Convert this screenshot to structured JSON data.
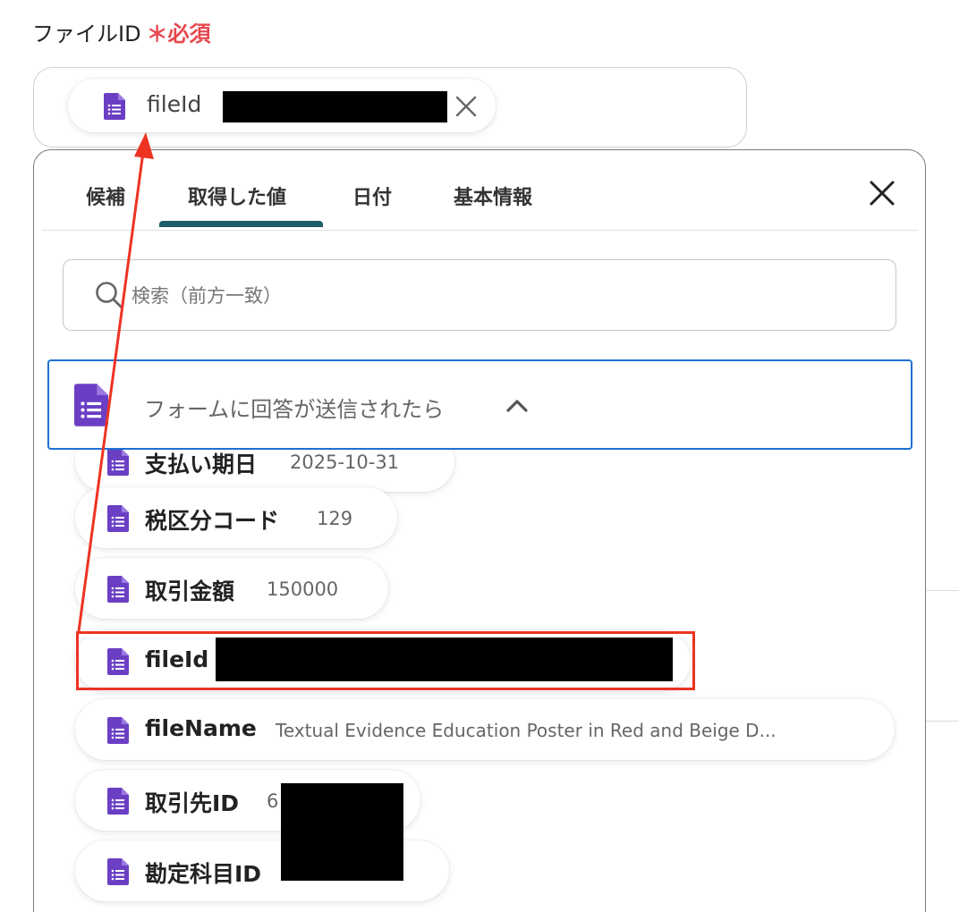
{
  "field": {
    "label": "ファイルID",
    "required_mark": "＊必須",
    "chip_label": "fileId"
  },
  "tabs": [
    {
      "label": "候補"
    },
    {
      "label": "取得した値"
    },
    {
      "label": "日付"
    },
    {
      "label": "基本情報"
    }
  ],
  "active_tab": "取得した値",
  "search": {
    "placeholder": "検索（前方一致）"
  },
  "group": {
    "title": "フォームに回答が送信されたら"
  },
  "items": [
    {
      "name": "支払い期日",
      "value": "2025-10-31"
    },
    {
      "name": "税区分コード",
      "value": "129"
    },
    {
      "name": "取引金額",
      "value": "150000"
    },
    {
      "name": "fileId",
      "value": ""
    },
    {
      "name": "fileName",
      "value": "Textual Evidence Education Poster in Red and Beige D..."
    },
    {
      "name": "取引先ID",
      "value": "6"
    },
    {
      "name": "勘定科目ID",
      "value": ""
    }
  ],
  "colors": {
    "accent_tab": "#1c5f6b",
    "group_border": "#1f6fd6",
    "highlight": "#ee3322",
    "required": "#e5484d",
    "doc_icon": "#6b3fc4"
  }
}
